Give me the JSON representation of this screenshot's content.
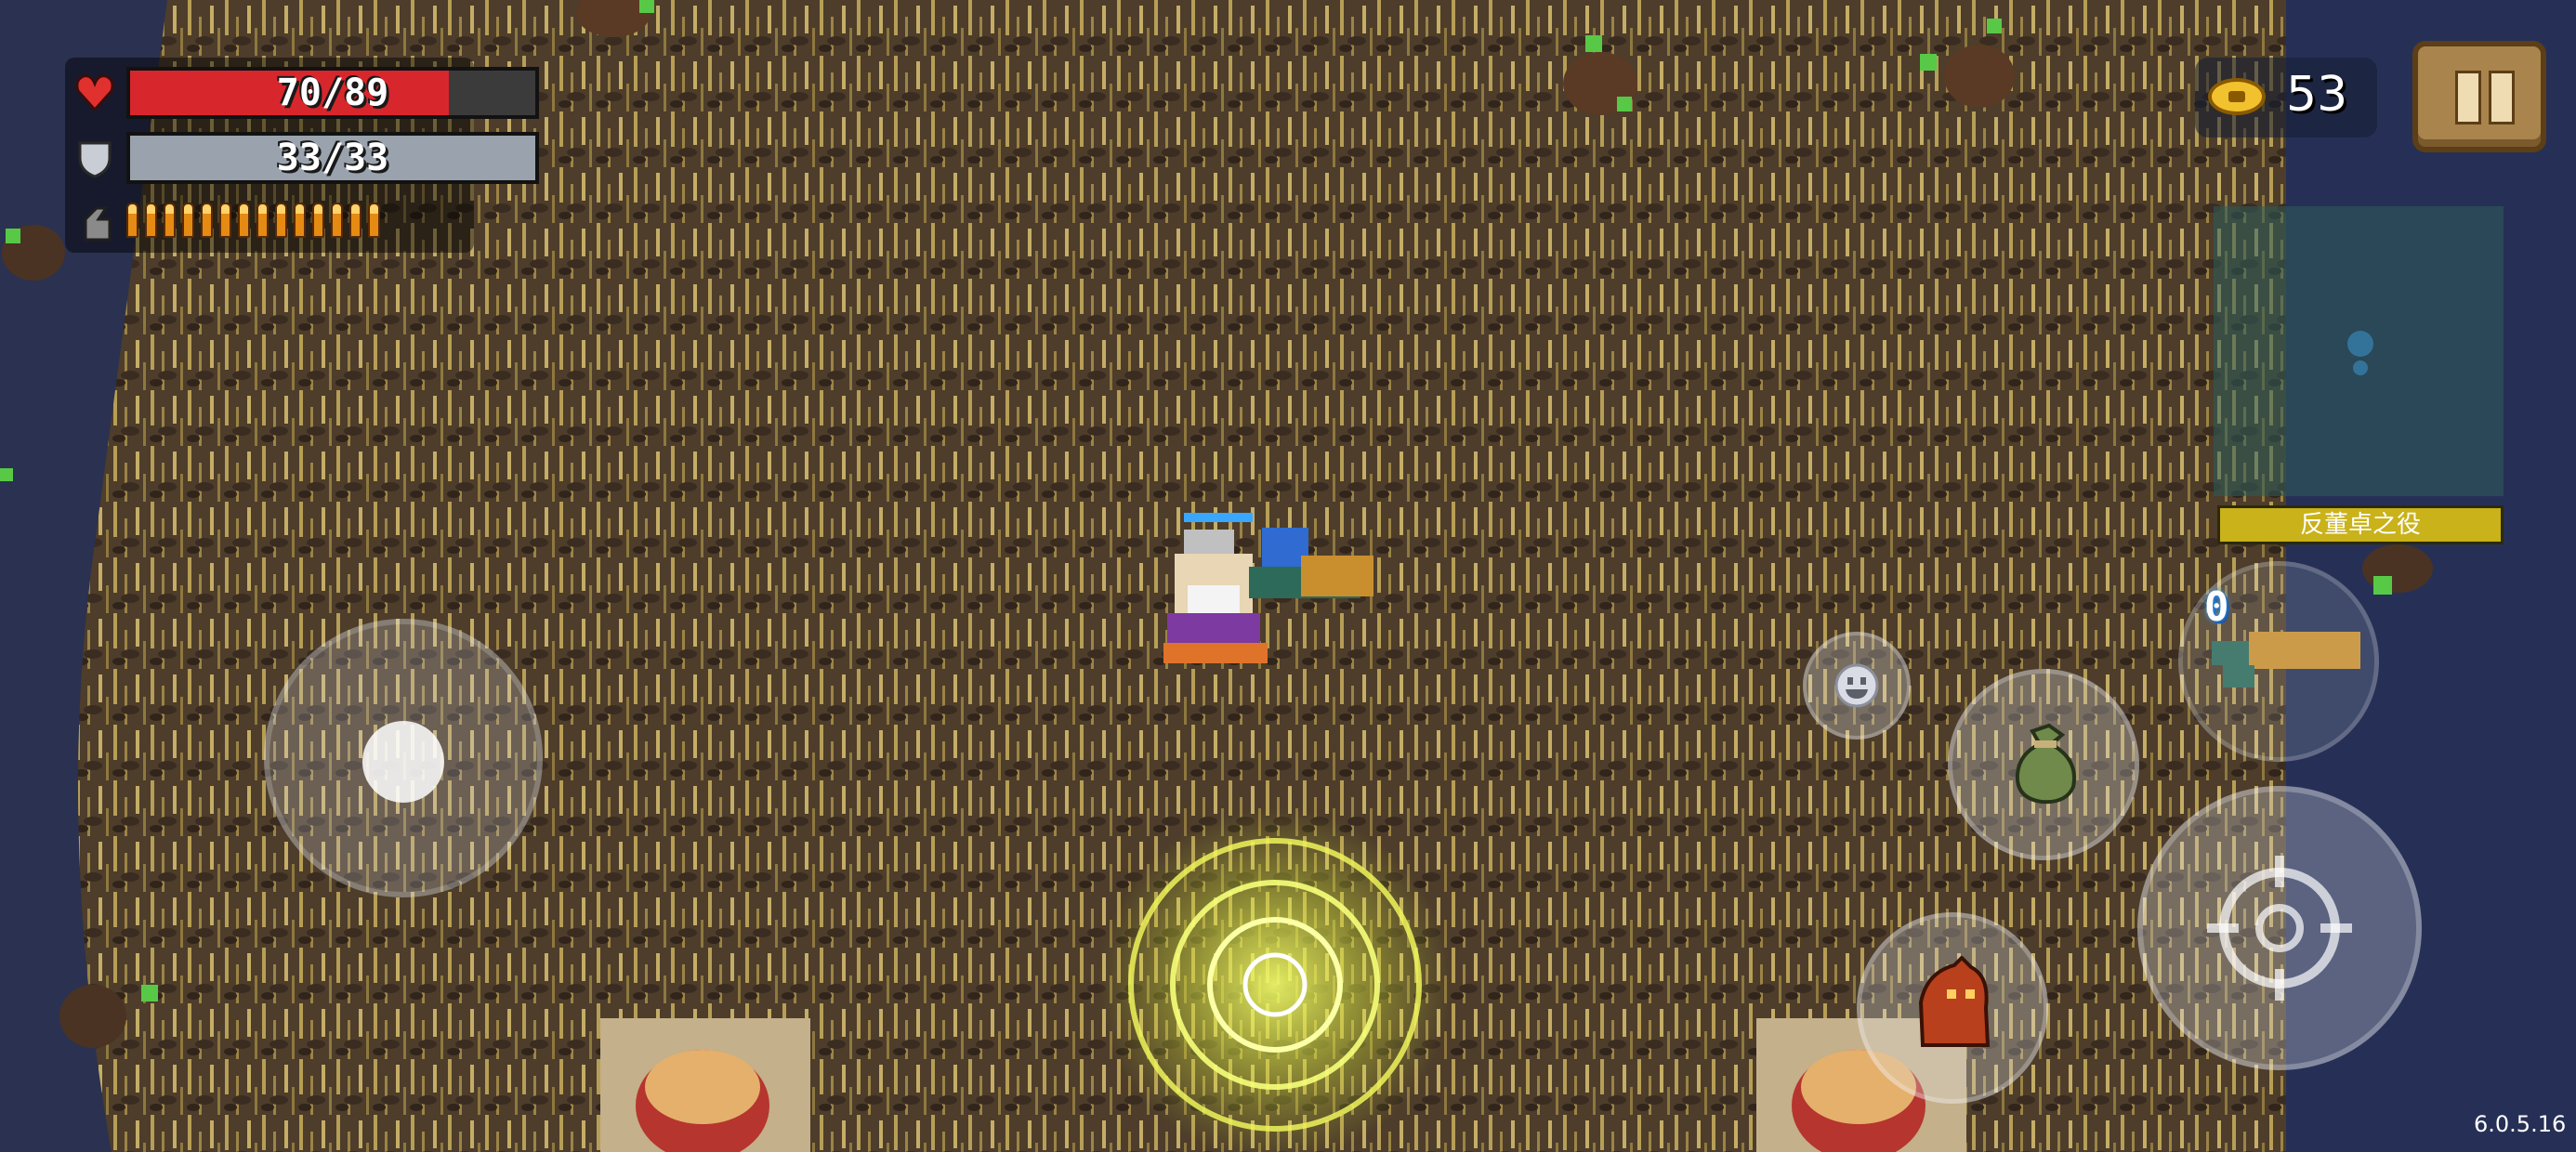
{
  "hud": {
    "health": {
      "text": "70/89",
      "fraction": 0.787,
      "color": "#d8262d"
    },
    "armor": {
      "text": "33/33",
      "fraction": 1.0,
      "color": "#9aa3ad"
    },
    "energy": {
      "bullets": 14,
      "color": "#f0a020"
    }
  },
  "coins": {
    "count": "53"
  },
  "quest": {
    "label": "反董卓之役"
  },
  "weapon": {
    "ammo": "0"
  },
  "controls": {
    "move_joystick": "joystick",
    "emote": "emote-icon",
    "item": "bag-icon",
    "skill": "skill-icon",
    "attack": "crosshair-icon",
    "swap_weapon": "weapon-icon"
  },
  "version": "6.0.5.16",
  "colors": {
    "floor": "#5a4a2c",
    "grass": "#b59a52",
    "portal": "#e8ef3a",
    "wall": "#1d2340"
  }
}
